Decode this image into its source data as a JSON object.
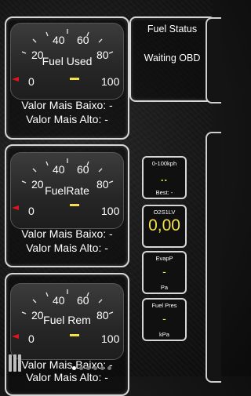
{
  "gauges": [
    {
      "title": "Fuel Used",
      "ticks": {
        "t0": "0",
        "t20": "20",
        "t40": "40",
        "t60": "60",
        "t80": "80",
        "t100": "100"
      },
      "value": "-",
      "low_label": "Valor Mais Baixo: -",
      "high_label": "Valor Mais Alto: -"
    },
    {
      "title": "FuelRate",
      "ticks": {
        "t0": "0",
        "t20": "20",
        "t40": "40",
        "t60": "60",
        "t80": "80",
        "t100": "100"
      },
      "value": "-",
      "low_label": "Valor Mais Baixo: -",
      "high_label": "Valor Mais Alto: -"
    },
    {
      "title": "Fuel Rem",
      "ticks": {
        "t0": "0",
        "t20": "20",
        "t40": "40",
        "t60": "60",
        "t80": "80",
        "t100": "100"
      },
      "value": "-",
      "low_label": "Valor Mais Baixo: -",
      "high_label": "Valor Mais Alto: -"
    }
  ],
  "fuel_status": {
    "title": "Fuel Status",
    "text": "Waiting OBD"
  },
  "small_boxes": [
    {
      "title": "0-100kph",
      "value": "..",
      "sub": "Best: -"
    },
    {
      "title": "O2S1LV",
      "value": "0,00",
      "sub": ""
    },
    {
      "title": "EvapP",
      "value": "-",
      "sub": "Pa"
    },
    {
      "title": "Fuel Pres",
      "value": "-",
      "sub": "kPa"
    }
  ],
  "colors": {
    "accent_yellow": "#f5e14a",
    "needle_red": "#e0141e",
    "border": "#d6d6d6"
  }
}
